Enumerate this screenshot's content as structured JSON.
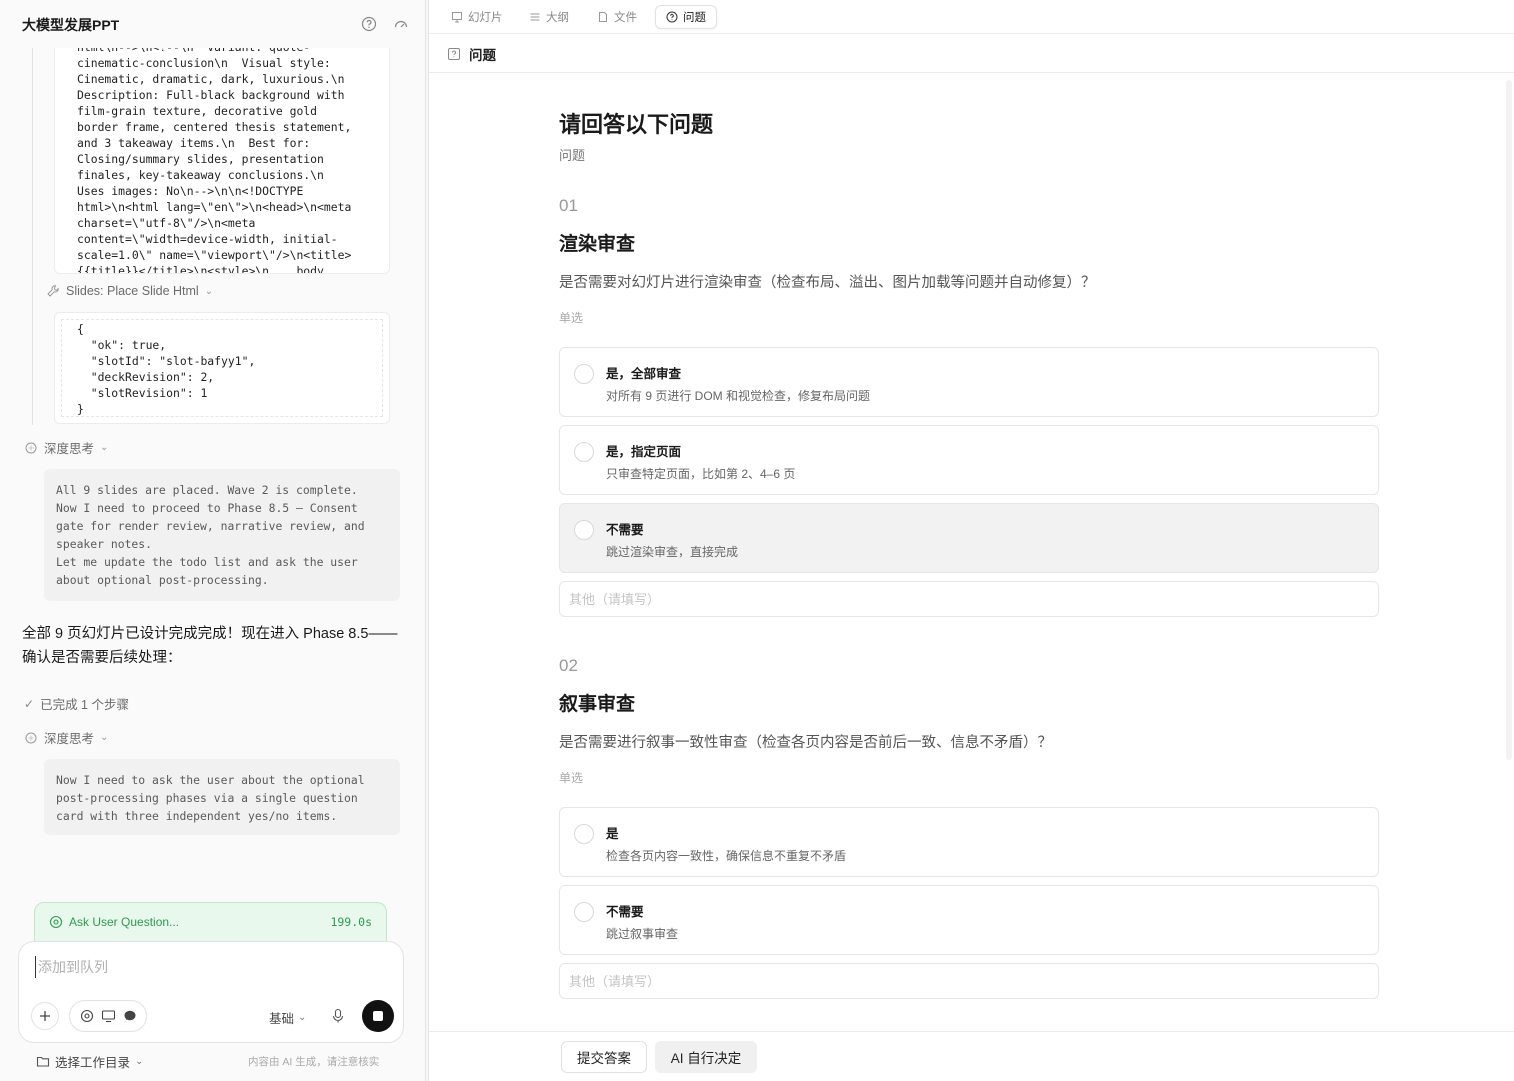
{
  "left": {
    "title": "大模型发展PPT",
    "code_top": "html\\n-->\\n<!--\\n  variant: quote-\ncinematic-conclusion\\n  Visual style:\nCinematic, dramatic, dark, luxurious.\\n\nDescription: Full-black background with\nfilm-grain texture, decorative gold\nborder frame, centered thesis statement,\nand 3 takeaway items.\\n  Best for:\nClosing/summary slides, presentation\nfinales, key-takeaway conclusions.\\n\nUses images: No\\n-->\\n\\n<!DOCTYPE\nhtml>\\n<html lang=\\\"en\\\">\\n<head>\\n<meta\ncharset=\\\"utf-8\\\"/>\\n<meta\ncontent=\\\"width=device-width, initial-\nscale=1.0\\\" name=\\\"viewport\\\"/>\\n<title>\n{{title}}</title>\\n<style>\\n    body",
    "tool_label": "Slides: Place Slide Html",
    "code_result": "{\n  \"ok\": true,\n  \"slotId\": \"slot-bafyy1\",\n  \"deckRevision\": 2,\n  \"slotRevision\": 1\n}",
    "think1_label": "深度思考",
    "think1_text": "All 9 slides are placed. Wave 2 is complete.\nNow I need to proceed to Phase 8.5 — Consent\ngate for render review, narrative review, and\nspeaker notes.\nLet me update the todo list and ask the user\nabout optional post-processing.",
    "message": "全部 9 页幻灯片已设计完成完成！现在进入 Phase 8.5——确认是否需要后续处理：",
    "steps_label": "已完成 1 个步骤",
    "think2_label": "深度思考",
    "think2_text": "Now I need to ask the user about the optional\npost-processing phases via a single question\ncard with three independent yes/no items.",
    "ask_label": "Ask User Question...",
    "ask_time": "199.0s",
    "composer_placeholder": "添加到队列",
    "mode_label": "基础",
    "workdir_label": "选择工作目录",
    "disclaimer": "内容由 AI 生成，请注意核实"
  },
  "right": {
    "tabs": [
      {
        "label": "幻灯片",
        "icon": "slides-icon"
      },
      {
        "label": "大纲",
        "icon": "outline-icon"
      },
      {
        "label": "文件",
        "icon": "file-icon"
      },
      {
        "label": "问题",
        "icon": "question-icon"
      }
    ],
    "subheader": "问题",
    "heading": "请回答以下问题",
    "heading_sub": "问题",
    "questions": [
      {
        "num": "01",
        "title": "渲染审查",
        "desc": "是否需要对幻灯片进行渲染审查（检查布局、溢出、图片加载等问题并自动修复）？",
        "type": "单选",
        "options": [
          {
            "label": "是，全部审查",
            "desc": "对所有 9 页进行 DOM 和视觉检查，修复布局问题"
          },
          {
            "label": "是，指定页面",
            "desc": "只审查特定页面，比如第 2、4–6 页"
          },
          {
            "label": "不需要",
            "desc": "跳过渲染审查，直接完成"
          }
        ],
        "other_placeholder": "其他（请填写）"
      },
      {
        "num": "02",
        "title": "叙事审查",
        "desc": "是否需要进行叙事一致性审查（检查各页内容是否前后一致、信息不矛盾）？",
        "type": "单选",
        "options": [
          {
            "label": "是",
            "desc": "检查各页内容一致性，确保信息不重复不矛盾"
          },
          {
            "label": "不需要",
            "desc": "跳过叙事审查"
          }
        ],
        "other_placeholder": "其他（请填写）"
      }
    ],
    "submit_label": "提交答案",
    "ai_label": "AI 自行决定"
  }
}
